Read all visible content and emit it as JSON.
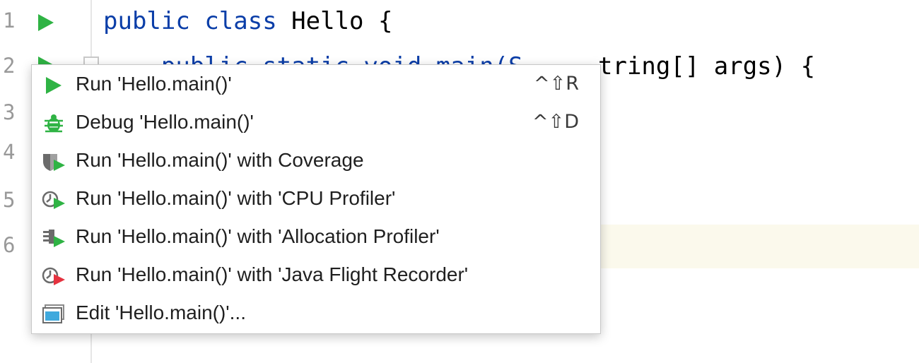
{
  "editor": {
    "line_numbers": [
      "1",
      "2",
      "3",
      "4",
      "5",
      "6"
    ],
    "code": {
      "line1": {
        "kw1": "public",
        "kw2": "class",
        "rest": "Hello {"
      },
      "line2_visible": "tring[] args) {",
      "line2_hidden": "    public static void main(S"
    }
  },
  "context_menu": {
    "items": [
      {
        "label": "Run 'Hello.main()'",
        "shortcut": "^⇧R",
        "icon": "run-icon"
      },
      {
        "label": "Debug 'Hello.main()'",
        "shortcut": "^⇧D",
        "icon": "debug-icon"
      },
      {
        "label": "Run 'Hello.main()' with Coverage",
        "shortcut": "",
        "icon": "coverage-icon"
      },
      {
        "label": "Run 'Hello.main()' with 'CPU Profiler'",
        "shortcut": "",
        "icon": "cpu-profiler-icon"
      },
      {
        "label": "Run 'Hello.main()' with 'Allocation Profiler'",
        "shortcut": "",
        "icon": "allocation-profiler-icon"
      },
      {
        "label": "Run 'Hello.main()' with 'Java Flight Recorder'",
        "shortcut": "",
        "icon": "flight-recorder-icon"
      },
      {
        "label": "Edit 'Hello.main()'...",
        "shortcut": "",
        "icon": "edit-configuration-icon"
      }
    ]
  },
  "colors": {
    "run_green": "#2fb344",
    "flight_red": "#e5323f",
    "keyword_blue": "#0b3ea8",
    "caret_line_bg": "#fbf9ec"
  }
}
